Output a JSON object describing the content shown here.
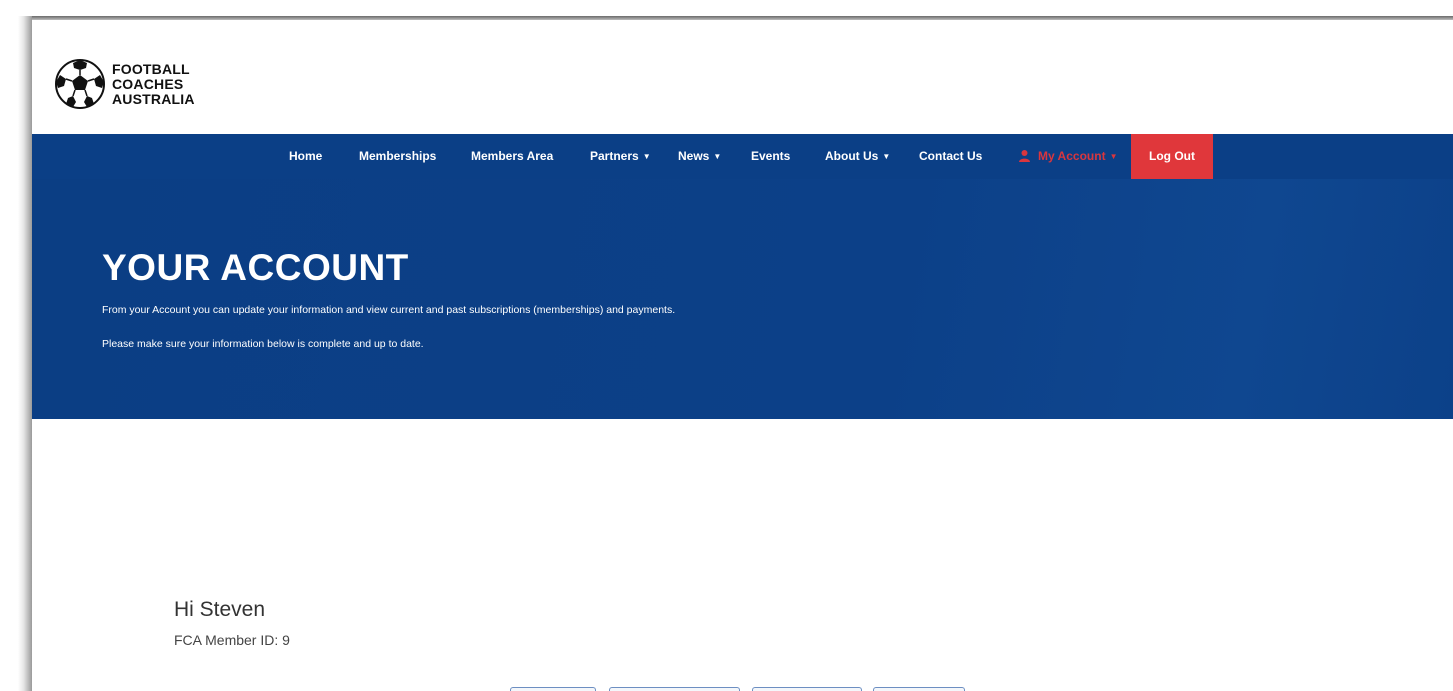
{
  "logo": {
    "lines": [
      "FOOTBALL",
      "COACHES",
      "AUSTRALIA"
    ],
    "icon": "soccer-ball-icon"
  },
  "nav": {
    "items": [
      {
        "label": "Home",
        "dropdown": false
      },
      {
        "label": "Memberships",
        "dropdown": false
      },
      {
        "label": "Members Area",
        "dropdown": false
      },
      {
        "label": "Partners",
        "dropdown": true
      },
      {
        "label": "News",
        "dropdown": true
      },
      {
        "label": "Events",
        "dropdown": false
      },
      {
        "label": "About Us",
        "dropdown": true
      },
      {
        "label": "Contact Us",
        "dropdown": false
      }
    ],
    "account": {
      "label": "My Account",
      "icon": "user-icon",
      "color": "#d9363e"
    },
    "logout": {
      "label": "Log Out",
      "color": "#e0373b"
    },
    "background": "#0b3f86",
    "chevron": "▼"
  },
  "hero": {
    "title": "YOUR ACCOUNT",
    "line1": "From your Account you can update your information and view current and past subscriptions (memberships) and payments.",
    "line2": "Please make sure your information below is complete and up to date."
  },
  "account": {
    "greeting": "Hi Steven",
    "member_id": "FCA Member ID: 9"
  }
}
